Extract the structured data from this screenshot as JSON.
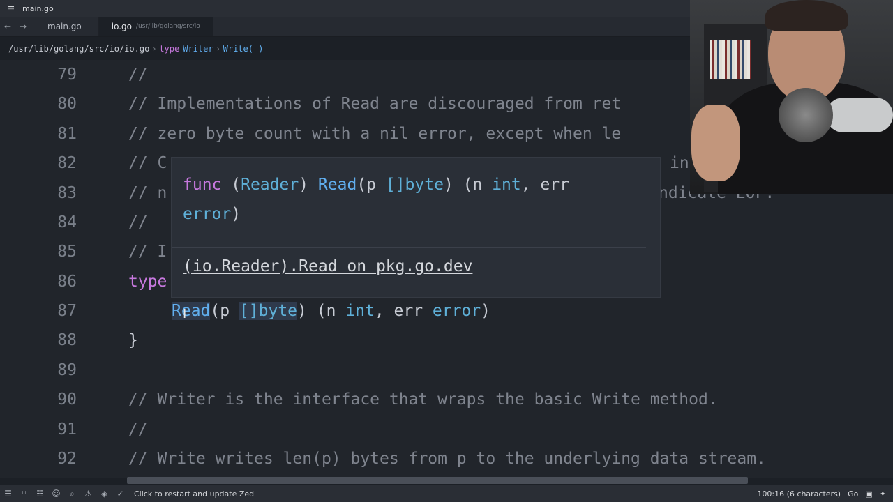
{
  "window": {
    "title": "main.go"
  },
  "tabs": [
    {
      "label": "main.go",
      "path": ""
    },
    {
      "label": "io.go",
      "path": "/usr/lib/golang/src/io"
    }
  ],
  "breadcrumb": {
    "path": "/usr/lib/golang/src/io/io.go",
    "keyword": "type",
    "type_name": "Writer",
    "member": "Write( )"
  },
  "lines": {
    "n79": "79",
    "n80": "80",
    "n81": "81",
    "n82": "82",
    "n83": "83",
    "n84": "84",
    "n85": "85",
    "n86": "86",
    "n87": "87",
    "n88": "88",
    "n89": "89",
    "n90": "90",
    "n91": "91",
    "n92": "92",
    "l79": "//",
    "l80": "// Implementations of Read are discouraged from ret",
    "l81": "// zero byte count with a nil error, except when le",
    "l82a": "// C",
    "l82b": "in",
    "l83a": "// n",
    "l83b": "ndicate EOF.",
    "l84": "//",
    "l85": "// I",
    "l86_kw": "type",
    "l87_fn": "Read",
    "l87_p": "(p ",
    "l87_ty": "[]byte",
    "l87_rest1": ") (n ",
    "l87_int": "int",
    "l87_rest2": ", err ",
    "l87_err": "error",
    "l87_end": ")",
    "l88": "}",
    "l90": "// Writer is the interface that wraps the basic Write method.",
    "l91": "//",
    "l92": "// Write writes len(p) bytes from p to the underlying data stream."
  },
  "hover": {
    "kw": "func",
    "recv": "(Reader)",
    "fn": "Read",
    "params_open": "(p ",
    "params_ty": "[]byte",
    "params_mid": ") (n ",
    "int": "int",
    "err": ", err",
    "error": "error",
    "close": ")",
    "link": "(io.Reader).Read on pkg.go.dev"
  },
  "status": {
    "message": "Click to restart and update Zed",
    "position": "100:16 (6 characters)",
    "language": "Go"
  },
  "colors": {
    "background": "#21252b",
    "keyword": "#c678dd",
    "function": "#61afef",
    "comment": "#7f848e"
  }
}
